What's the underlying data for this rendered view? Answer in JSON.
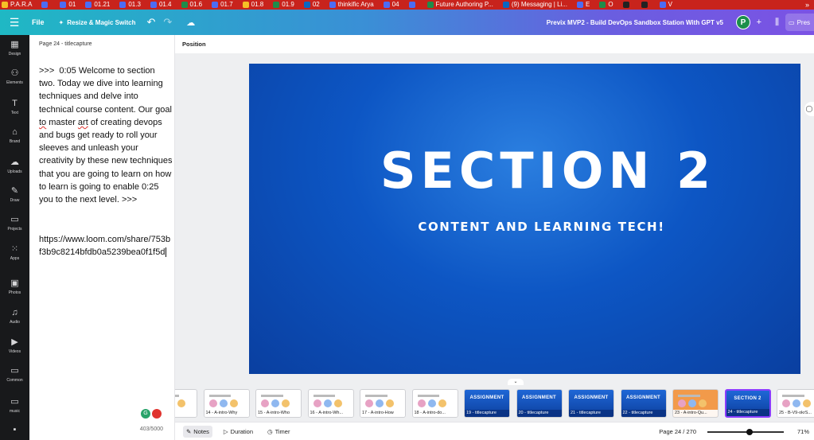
{
  "bookmarks": [
    {
      "label": "P.A.R.A",
      "color": "#f6c026"
    },
    {
      "label": "",
      "color": "#4b6cf5"
    },
    {
      "label": "01",
      "color": "#4b6cf5"
    },
    {
      "label": "01.21",
      "color": "#4b6cf5"
    },
    {
      "label": "01.3",
      "color": "#4b6cf5"
    },
    {
      "label": "01.4",
      "color": "#4b6cf5"
    },
    {
      "label": "01.6",
      "color": "#1f8c4a"
    },
    {
      "label": "01.7",
      "color": "#4b6cf5"
    },
    {
      "label": "01.8",
      "color": "#f6c026"
    },
    {
      "label": "01.9",
      "color": "#1f8c4a"
    },
    {
      "label": "02",
      "color": "#0a66c2"
    },
    {
      "label": "thinkific Arya",
      "color": "#4b6cf5"
    },
    {
      "label": "04",
      "color": "#4b6cf5"
    },
    {
      "label": "",
      "color": "#4b6cf5"
    },
    {
      "label": "Future Authoring P...",
      "color": "#1f8c4a"
    },
    {
      "label": "(9) Messaging | Li...",
      "color": "#0a66c2"
    },
    {
      "label": "E",
      "color": "#4b6cf5"
    },
    {
      "label": "O",
      "color": "#1f8c4a"
    },
    {
      "label": "",
      "color": "#222"
    },
    {
      "label": "",
      "color": "#222"
    },
    {
      "label": "V",
      "color": "#4b6cf5"
    }
  ],
  "bookmarks_more": "»",
  "toolbar": {
    "menu_icon": "☰",
    "file_label": "File",
    "resize_label": "Resize & Magic Switch",
    "undo_icon": "↶",
    "redo_icon": "↷",
    "cloud_icon": "☁",
    "design_title": "Previx MVP2 - Build DevOps Sandbox Station  With GPT v5",
    "avatar_letter": "P",
    "plus_icon": "+",
    "stats_icon": "⫼",
    "present_label": "Pres"
  },
  "rail": [
    {
      "icon": "▦",
      "label": "Design"
    },
    {
      "icon": "⚇",
      "label": "Elements"
    },
    {
      "icon": "T",
      "label": "Text"
    },
    {
      "icon": "⌂",
      "label": "Brand"
    },
    {
      "icon": "☁",
      "label": "Uploads"
    },
    {
      "icon": "✎",
      "label": "Draw"
    },
    {
      "icon": "▭",
      "label": "Projects"
    },
    {
      "icon": "⁙",
      "label": "Apps"
    },
    {
      "icon": "▣",
      "label": "Photos"
    },
    {
      "icon": "♫",
      "label": "Audio"
    },
    {
      "icon": "▶",
      "label": "Videos"
    },
    {
      "icon": "▭",
      "label": "Common"
    },
    {
      "icon": "▭",
      "label": "music"
    },
    {
      "icon": "▪",
      "label": ""
    }
  ],
  "notes": {
    "title": "Page 24 - titlecapture",
    "body_pre": ">>>  0:05 Welcome to section two. Today we dive into learning techniques and delve into technical course content. Our goal ",
    "body_sq1": "to",
    "body_mid1": " master ",
    "body_sq2": "art",
    "body_mid2": " of creating devops and bugs get ready to roll your sleeves and unleash your creativity by these new techniques that you are going to learn on how to learn is going to enable 0:25 you to the next level. >>>",
    "link": "https://www.loom.com/share/753bf3b9c8214bfdb0a5239bea0f1f5d",
    "char_count": "403/5000"
  },
  "canvas": {
    "position_label": "Position",
    "slide_title": "SECTION 2",
    "slide_subtitle": "CONTENT AND LEARNING TECH!",
    "comment_icon": "◯",
    "collapse_icon": "⌄"
  },
  "thumbnails": [
    {
      "caption": "-Why",
      "style": "white"
    },
    {
      "caption": "14 - A-intro-Why",
      "style": "white"
    },
    {
      "caption": "15 - A-intro-Who",
      "style": "white"
    },
    {
      "caption": "16 - A-intro-Wh...",
      "style": "white"
    },
    {
      "caption": "17 - A-intro-How",
      "style": "white"
    },
    {
      "caption": "18 - A-intro-do...",
      "style": "white"
    },
    {
      "caption": "19 - titlecapture",
      "style": "blue",
      "head": "ASSIGNMENT"
    },
    {
      "caption": "20 - titlecapture",
      "style": "blue",
      "head": "ASSIGNMENT"
    },
    {
      "caption": "21 - titlecapture",
      "style": "blue",
      "head": "ASSIGNMENT"
    },
    {
      "caption": "22 - titlecapture",
      "style": "blue",
      "head": "ASSIGNMENT"
    },
    {
      "caption": "23 - A-intro-Qu...",
      "style": "orange"
    },
    {
      "caption": "24 - titlecapture",
      "style": "blue",
      "head": "SECTION 2",
      "selected": true
    },
    {
      "caption": "25 - B-V9-okrS...",
      "style": "white"
    }
  ],
  "bottombar": {
    "notes_label": "Notes",
    "duration_label": "Duration",
    "timer_label": "Timer",
    "page_indicator": "Page 24 / 270",
    "zoom_value": "71%",
    "zoom_level": 0.55
  }
}
